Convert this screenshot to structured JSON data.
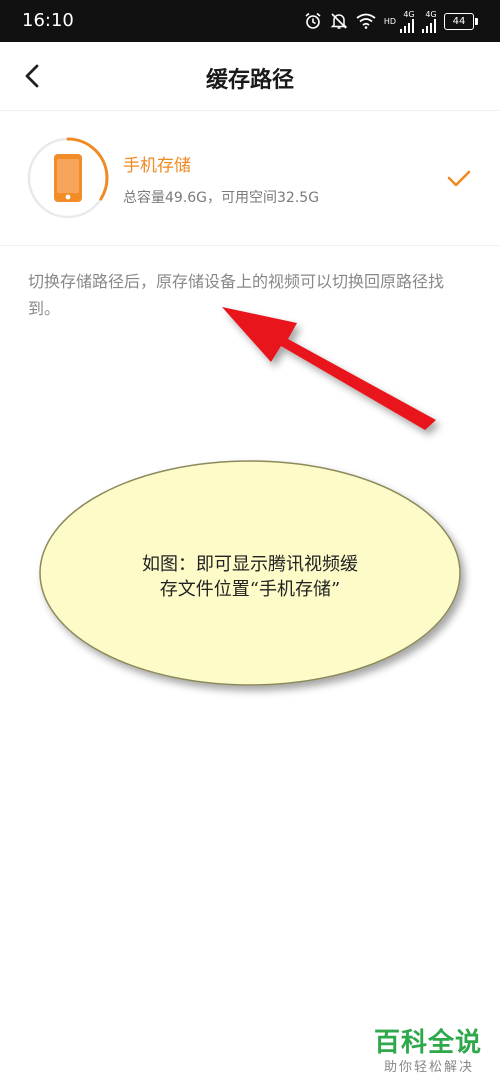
{
  "status_bar": {
    "time": "16:10",
    "net1": "4G",
    "net2": "4G",
    "hd": "HD",
    "battery": "44"
  },
  "header": {
    "title": "缓存路径",
    "back_icon": "chevron-left-icon"
  },
  "storage": {
    "name": "手机存储",
    "detail": "总容量49.6G，可用空间32.5G",
    "selected": true,
    "used_fraction": 0.34,
    "accent_color": "#f08a24"
  },
  "notice": {
    "text": "切换存储路径后，原存储设备上的视频可以切换回原路径找到。"
  },
  "annotation": {
    "line1": "如图：即可显示腾讯视频缓",
    "line2": "存文件位置“手机存储”",
    "arrow_color": "#e8141c",
    "bubble_color": "#fdfbc8"
  },
  "watermark": {
    "brand": "百科全说",
    "sub": "助你轻松解决"
  }
}
